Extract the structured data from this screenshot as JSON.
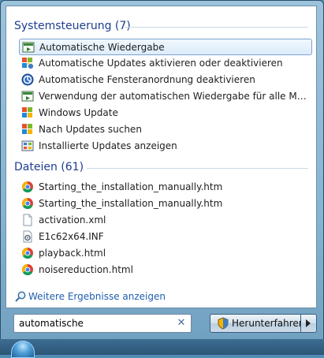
{
  "groups": [
    {
      "title": "Systemsteuerung (7)",
      "items": [
        {
          "label": "Automatische Wiedergabe",
          "icon": "autoplay-icon"
        },
        {
          "label": "Automatische Updates aktivieren oder deaktivieren",
          "icon": "windows-update-icon"
        },
        {
          "label": "Automatische Fensteranordnung deaktivieren",
          "icon": "ease-of-access-icon"
        },
        {
          "label": "Verwendung der automatischen Wiedergabe für alle Medien un...",
          "icon": "autoplay-icon"
        },
        {
          "label": "Windows Update",
          "icon": "windows-update-icon"
        },
        {
          "label": "Nach Updates suchen",
          "icon": "windows-update-icon"
        },
        {
          "label": "Installierte Updates anzeigen",
          "icon": "programs-icon"
        }
      ]
    },
    {
      "title": "Dateien (61)",
      "items": [
        {
          "label": "Starting_the_installation_manually.htm",
          "icon": "chrome-icon"
        },
        {
          "label": "Starting_the_installation_manually.htm",
          "icon": "chrome-icon"
        },
        {
          "label": "activation.xml",
          "icon": "document-icon"
        },
        {
          "label": "E1c62x64.INF",
          "icon": "settings-file-icon"
        },
        {
          "label": "playback.html",
          "icon": "chrome-icon"
        },
        {
          "label": "noisereduction.html",
          "icon": "chrome-icon"
        }
      ]
    }
  ],
  "more_results": "Weitere Ergebnisse anzeigen",
  "search": {
    "value": "automatische"
  },
  "shutdown_label": "Herunterfahren"
}
